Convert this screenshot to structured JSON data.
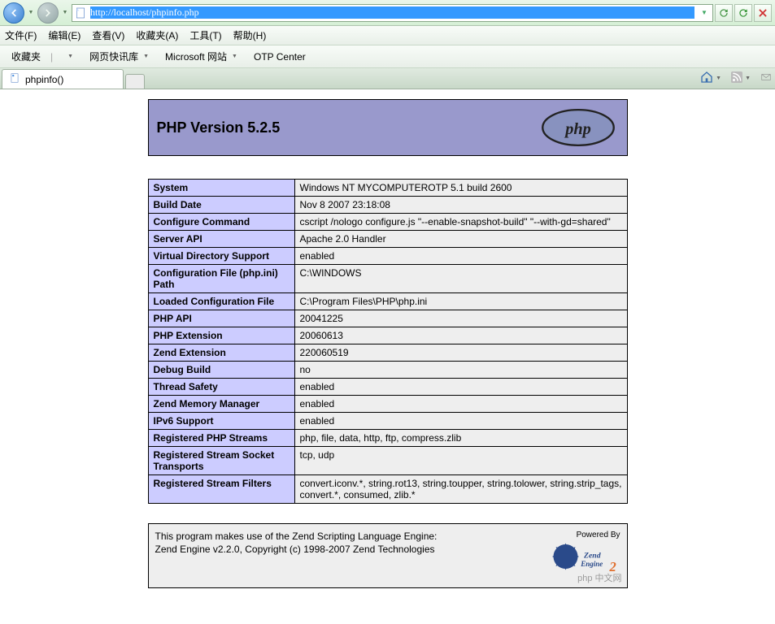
{
  "browser": {
    "url": "http://localhost/phpinfo.php"
  },
  "menus": {
    "file": "文件(F)",
    "edit": "编辑(E)",
    "view": "查看(V)",
    "favorites": "收藏夹(A)",
    "tools": "工具(T)",
    "help": "帮助(H)"
  },
  "favbar": {
    "label": "收藏夹",
    "newsfeed": "网页快讯库",
    "ms_site": "Microsoft 网站",
    "otp": "OTP Center"
  },
  "tab": {
    "title": "phpinfo()"
  },
  "phpinfo": {
    "header": "PHP Version 5.2.5",
    "rows": [
      {
        "k": "System",
        "v": "Windows NT MYCOMPUTEROTP 5.1 build 2600"
      },
      {
        "k": "Build Date",
        "v": "Nov 8 2007 23:18:08"
      },
      {
        "k": "Configure Command",
        "v": "cscript /nologo configure.js \"--enable-snapshot-build\" \"--with-gd=shared\""
      },
      {
        "k": "Server API",
        "v": "Apache 2.0 Handler"
      },
      {
        "k": "Virtual Directory Support",
        "v": "enabled"
      },
      {
        "k": "Configuration File (php.ini) Path",
        "v": "C:\\WINDOWS"
      },
      {
        "k": "Loaded Configuration File",
        "v": "C:\\Program Files\\PHP\\php.ini"
      },
      {
        "k": "PHP API",
        "v": "20041225"
      },
      {
        "k": "PHP Extension",
        "v": "20060613"
      },
      {
        "k": "Zend Extension",
        "v": "220060519"
      },
      {
        "k": "Debug Build",
        "v": "no"
      },
      {
        "k": "Thread Safety",
        "v": "enabled"
      },
      {
        "k": "Zend Memory Manager",
        "v": "enabled"
      },
      {
        "k": "IPv6 Support",
        "v": "enabled"
      },
      {
        "k": "Registered PHP Streams",
        "v": "php, file, data, http, ftp, compress.zlib"
      },
      {
        "k": "Registered Stream Socket Transports",
        "v": "tcp, udp"
      },
      {
        "k": "Registered Stream Filters",
        "v": "convert.iconv.*, string.rot13, string.toupper, string.tolower, string.strip_tags, convert.*, consumed, zlib.*"
      }
    ],
    "zend_line1": "This program makes use of the Zend Scripting Language Engine:",
    "zend_line2": "Zend Engine v2.2.0, Copyright (c) 1998-2007 Zend Technologies",
    "zend_powered": "Powered By"
  },
  "watermark": "php 中文网"
}
